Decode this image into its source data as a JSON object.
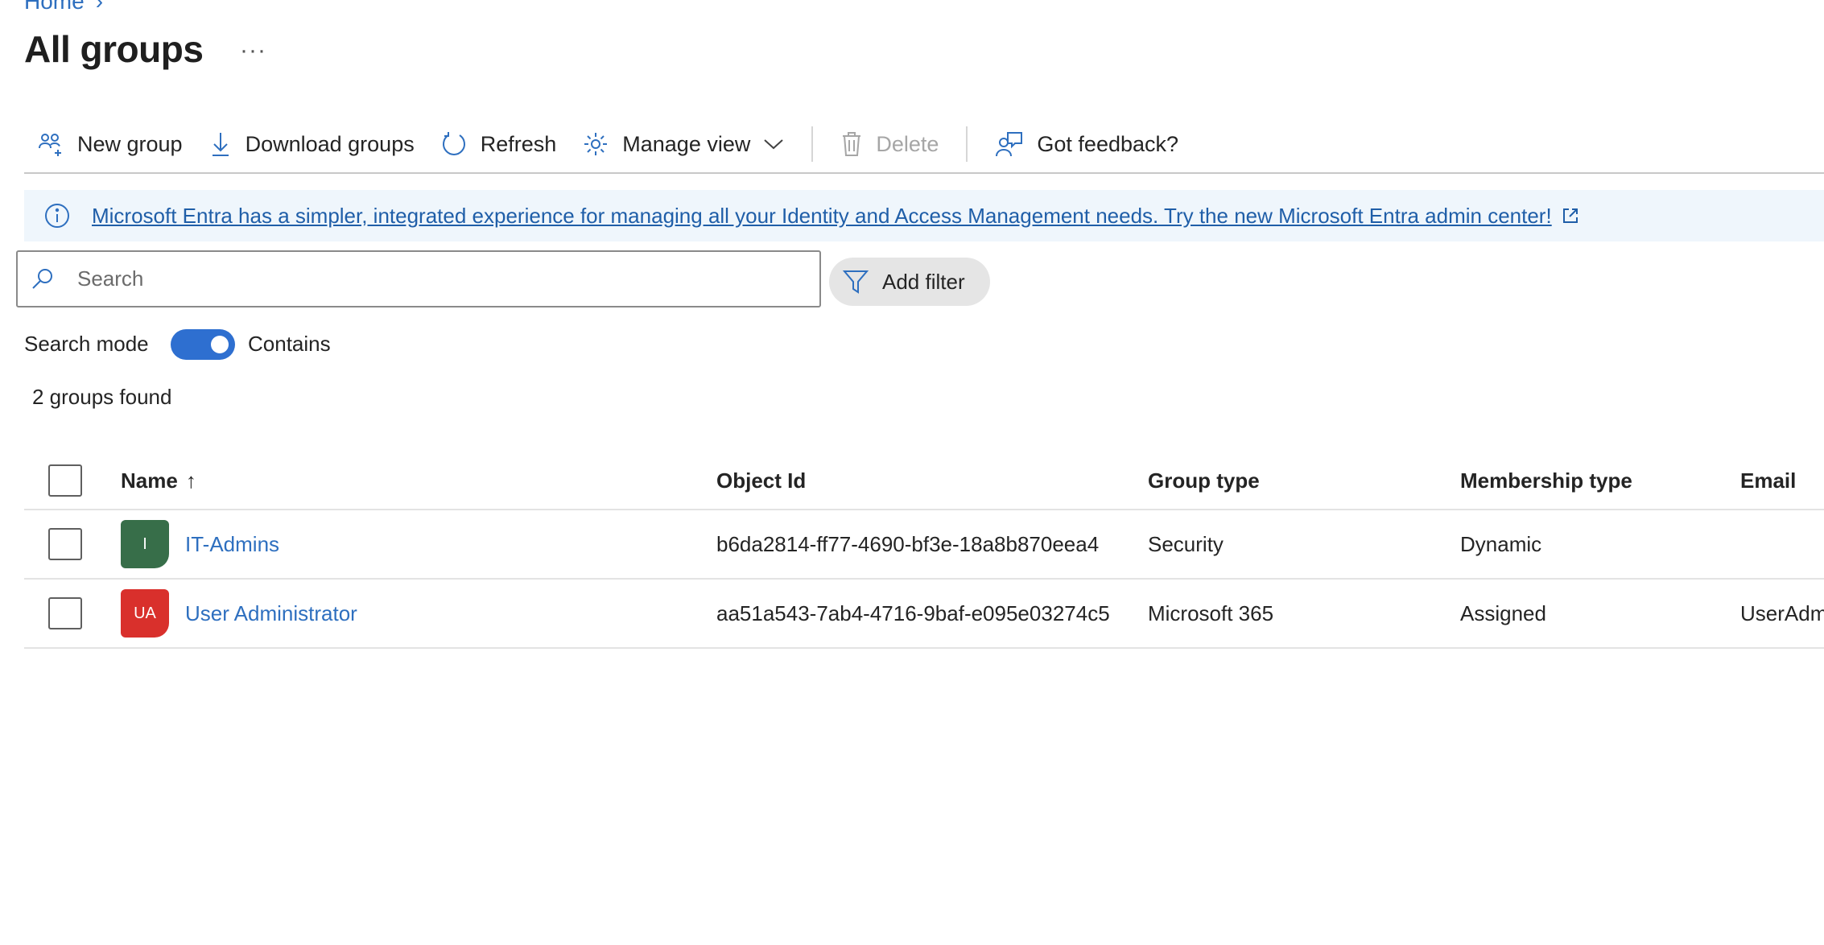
{
  "breadcrumb": {
    "home": "Home",
    "separator": "›"
  },
  "header": {
    "title": "All groups",
    "more": "···"
  },
  "toolbar": {
    "new_group": "New group",
    "download_groups": "Download groups",
    "refresh": "Refresh",
    "manage_view": "Manage view",
    "delete": "Delete",
    "feedback": "Got feedback?"
  },
  "banner": {
    "text": "Microsoft Entra has a simpler, integrated experience for managing all your Identity and Access Management needs. Try the new Microsoft Entra admin center!"
  },
  "search": {
    "placeholder": "Search",
    "value": ""
  },
  "filter": {
    "label": "Add filter"
  },
  "search_mode": {
    "label": "Search mode",
    "toggle_label": "Contains",
    "enabled": true
  },
  "results": {
    "count_text": "2 groups found"
  },
  "table": {
    "columns": {
      "name": "Name",
      "sort_indicator": "↑",
      "object_id": "Object Id",
      "group_type": "Group type",
      "membership_type": "Membership type",
      "email": "Email"
    },
    "rows": [
      {
        "initials": "I",
        "avatar_color": "#376e49",
        "name": "IT-Admins",
        "object_id": "b6da2814-ff77-4690-bf3e-18a8b870eea4",
        "group_type": "Security",
        "membership_type": "Dynamic",
        "email": ""
      },
      {
        "initials": "UA",
        "avatar_color": "#d9302c",
        "name": "User Administrator",
        "object_id": "aa51a543-7ab4-4716-9baf-e095e03274c5",
        "group_type": "Microsoft 365",
        "membership_type": "Assigned",
        "email": "UserAdm"
      }
    ]
  },
  "colors": {
    "accent": "#2e6fd0",
    "link": "#2e6fbf",
    "banner_bg": "#eff6fc"
  }
}
